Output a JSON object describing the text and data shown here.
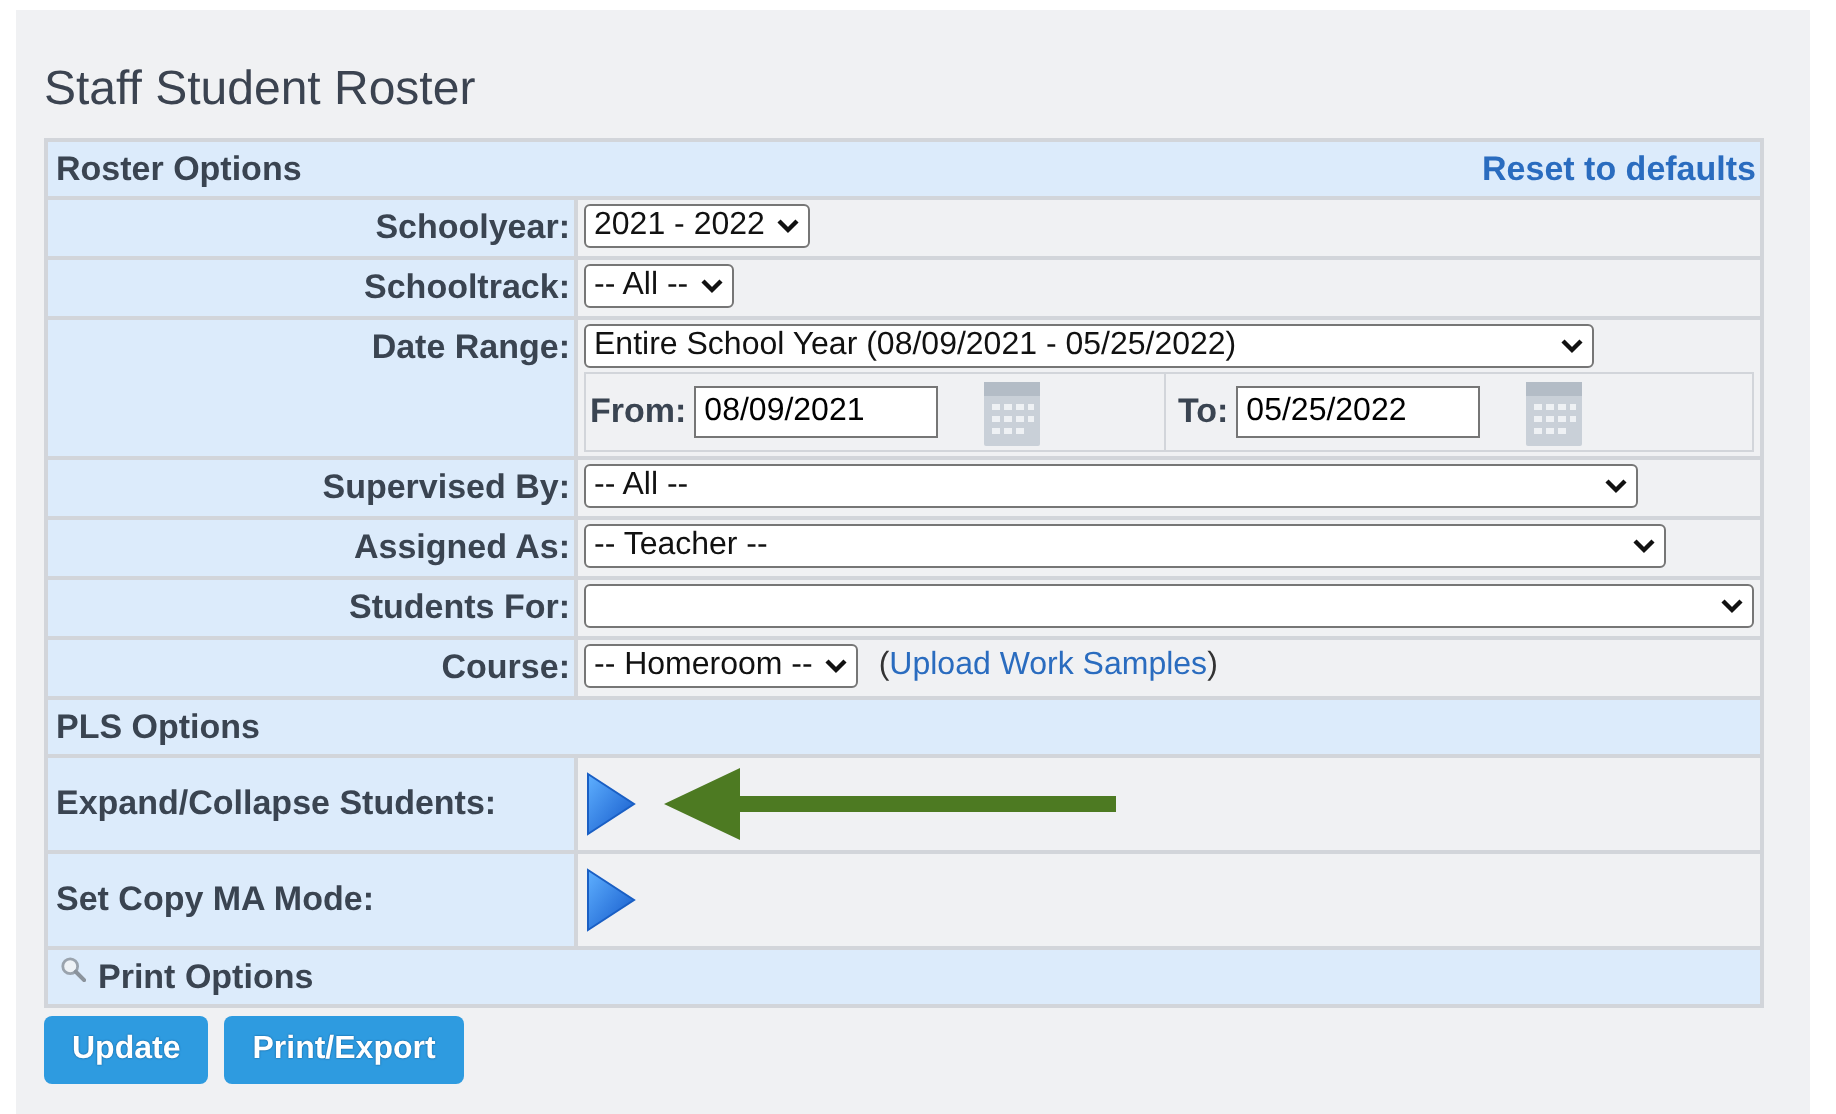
{
  "title": "Staff Student Roster",
  "rows": [
    {
      "kind": "header",
      "label": "Roster Options",
      "link": "Reset to defaults"
    },
    {
      "kind": "select",
      "label": "Schoolyear:",
      "value": "2021 - 2022"
    },
    {
      "kind": "select",
      "label": "Schooltrack:",
      "value": "-- All --"
    },
    {
      "kind": "daterange",
      "label": "Date Range:",
      "value": "Entire School Year (08/09/2021 - 05/25/2022)",
      "from_label": "From:",
      "from": "08/09/2021",
      "to_label": "To:",
      "to": "05/25/2022"
    },
    {
      "kind": "select",
      "label": "Supervised By:",
      "value": "-- All --"
    },
    {
      "kind": "select",
      "label": "Assigned As:",
      "value": "-- Teacher --"
    },
    {
      "kind": "select",
      "label": "Students For:"
    },
    {
      "kind": "select",
      "label": "Course:",
      "value": "-- Homeroom --",
      "link_before": "(",
      "link": "Upload Work Samples",
      "link_after": ")"
    },
    {
      "kind": "header",
      "label": "PLS Options"
    },
    {
      "kind": "toggle",
      "label": "Expand/Collapse Students:",
      "annotated": true
    },
    {
      "kind": "toggle",
      "label": "Set Copy MA Mode:",
      "annotated": false
    },
    {
      "kind": "header",
      "label": "Print Options",
      "icon": true
    }
  ],
  "buttons": [
    "Update",
    "Print/Export"
  ]
}
